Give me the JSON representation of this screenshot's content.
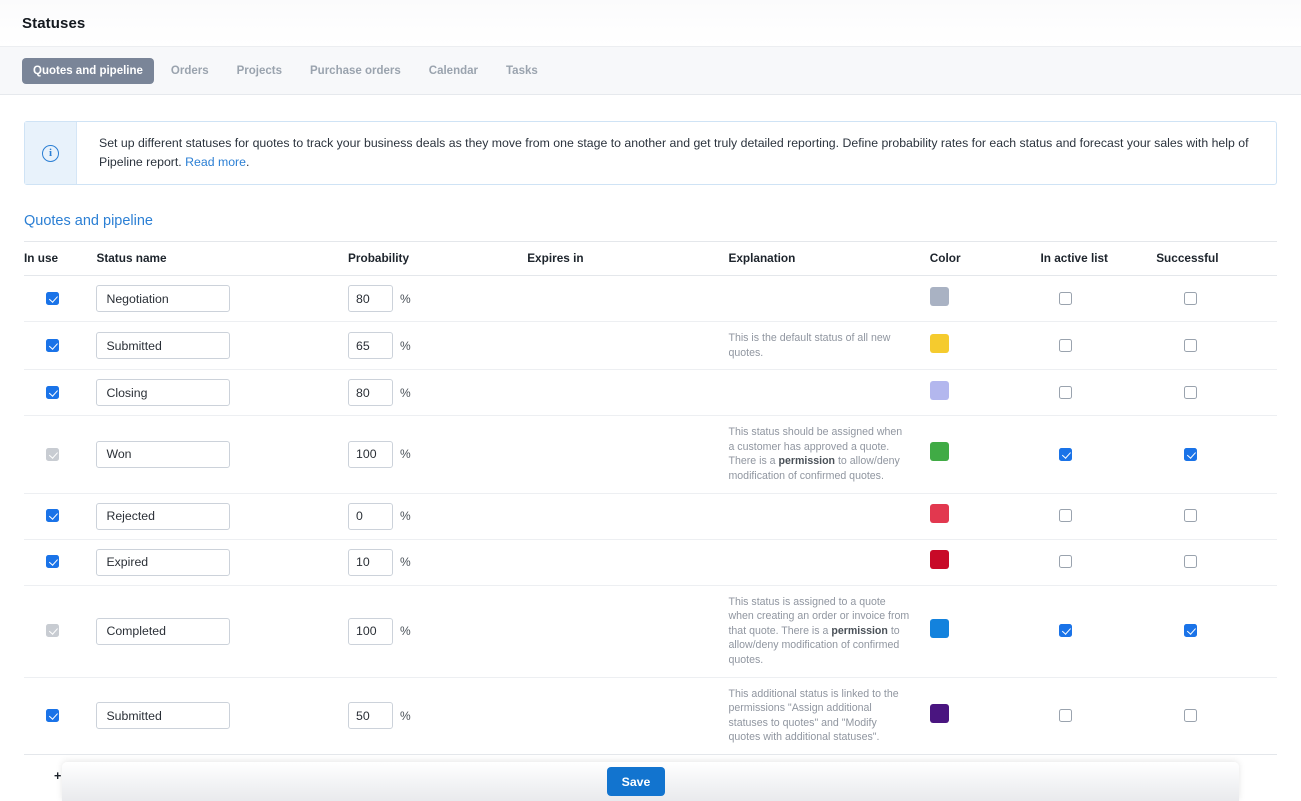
{
  "page": {
    "title": "Statuses"
  },
  "tabs": [
    {
      "label": "Quotes and pipeline",
      "active": true
    },
    {
      "label": "Orders",
      "active": false
    },
    {
      "label": "Projects",
      "active": false
    },
    {
      "label": "Purchase orders",
      "active": false
    },
    {
      "label": "Calendar",
      "active": false
    },
    {
      "label": "Tasks",
      "active": false
    }
  ],
  "banner": {
    "icon": "info-icon",
    "text": "Set up different statuses for quotes to track your business deals as they move from one stage to another and get truly detailed reporting. Define probability rates for each status and forecast your sales with help of Pipeline report. ",
    "link_label": "Read more",
    "text_after_link": "."
  },
  "section": {
    "title": "Quotes and pipeline"
  },
  "table": {
    "headers": {
      "in_use": "In use",
      "status_name": "Status name",
      "probability": "Probability",
      "expires_in": "Expires in",
      "explanation": "Explanation",
      "color": "Color",
      "in_active_list": "In active list",
      "successful": "Successful"
    },
    "percent_sign": "%",
    "rows": [
      {
        "in_use": true,
        "in_use_disabled": false,
        "name": "Negotiation",
        "probability": "80",
        "expires_in": "",
        "explanation_pre": "",
        "explanation_bold": "",
        "explanation_post": "",
        "color": "#a9b2c3",
        "in_active_list": false,
        "successful": false
      },
      {
        "in_use": true,
        "in_use_disabled": false,
        "name": "Submitted",
        "probability": "65",
        "expires_in": "",
        "explanation_pre": "This is the default status of all new quotes.",
        "explanation_bold": "",
        "explanation_post": "",
        "color": "#f5cb2e",
        "in_active_list": false,
        "successful": false
      },
      {
        "in_use": true,
        "in_use_disabled": false,
        "name": "Closing",
        "probability": "80",
        "expires_in": "",
        "explanation_pre": "",
        "explanation_bold": "",
        "explanation_post": "",
        "color": "#b3b7ee",
        "in_active_list": false,
        "successful": false
      },
      {
        "in_use": true,
        "in_use_disabled": true,
        "name": "Won",
        "probability": "100",
        "expires_in": "",
        "explanation_pre": "This status should be assigned when a customer has approved a quote. There is a ",
        "explanation_bold": "permission",
        "explanation_post": " to allow/deny modification of confirmed quotes.",
        "color": "#40ab45",
        "in_active_list": true,
        "successful": true
      },
      {
        "in_use": true,
        "in_use_disabled": false,
        "name": "Rejected",
        "probability": "0",
        "expires_in": "",
        "explanation_pre": "",
        "explanation_bold": "",
        "explanation_post": "",
        "color": "#e2384f",
        "in_active_list": false,
        "successful": false
      },
      {
        "in_use": true,
        "in_use_disabled": false,
        "name": "Expired",
        "probability": "10",
        "expires_in": "",
        "explanation_pre": "",
        "explanation_bold": "",
        "explanation_post": "",
        "color": "#c80a28",
        "in_active_list": false,
        "successful": false
      },
      {
        "in_use": true,
        "in_use_disabled": true,
        "name": "Completed",
        "probability": "100",
        "expires_in": "",
        "explanation_pre": "This status is assigned to a quote when creating an order or invoice from that quote. There is a ",
        "explanation_bold": "permission",
        "explanation_post": " to allow/deny modification of confirmed quotes.",
        "color": "#1382dd",
        "in_active_list": true,
        "successful": true
      },
      {
        "in_use": true,
        "in_use_disabled": false,
        "name": "Submitted",
        "probability": "50",
        "expires_in": "",
        "explanation_pre": "This additional status is linked to the permissions \"Assign additional statuses to quotes\" and \"Modify quotes with additional statuses\".",
        "explanation_bold": "",
        "explanation_post": "",
        "color": "#4a1580",
        "in_active_list": false,
        "successful": false
      }
    ]
  },
  "add_another": {
    "label": "+ Add another"
  },
  "footer": {
    "save_label": "Save"
  },
  "colors": {
    "accent_blue": "#1274cf",
    "link_blue": "#2b7fd4",
    "tab_active_bg": "#7a8598",
    "checkbox_checked": "#1a73e8"
  }
}
